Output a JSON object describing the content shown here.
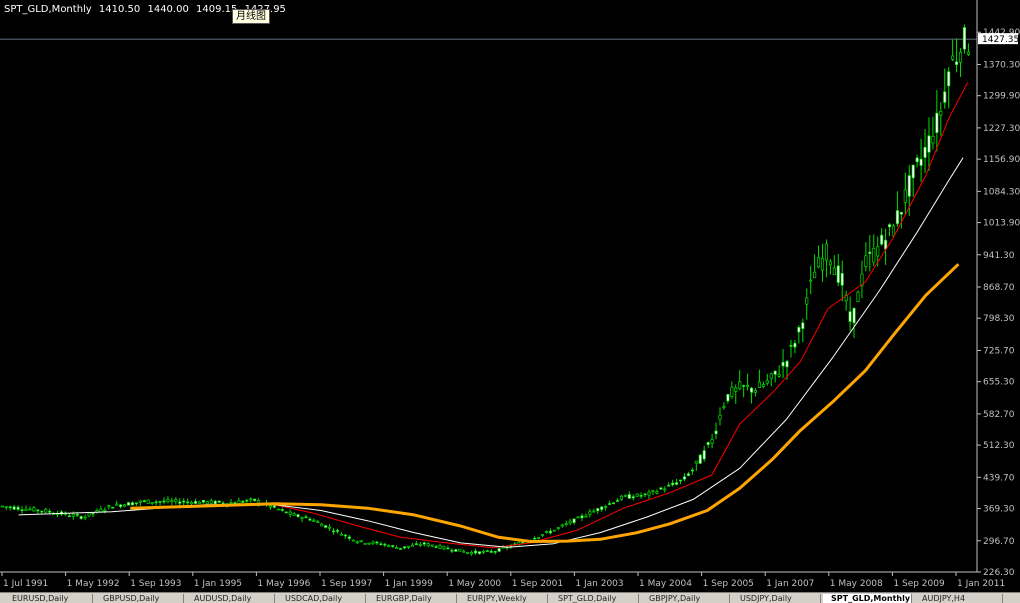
{
  "header": {
    "symbol": "SPT_GLD,Monthly",
    "open": "1410.50",
    "high": "1440.00",
    "low": "1409.15",
    "close": "1427.95"
  },
  "tooltip": "月线图",
  "tabs": [
    {
      "label": "EURUSD,Daily",
      "active": false
    },
    {
      "label": "GBPUSD,Daily",
      "active": false
    },
    {
      "label": "AUDUSD,Daily",
      "active": false
    },
    {
      "label": "USDCAD,Daily",
      "active": false
    },
    {
      "label": "EURGBP,Daily",
      "active": false
    },
    {
      "label": "EURJPY,Weekly",
      "active": false
    },
    {
      "label": "SPT_GLD,Daily",
      "active": false
    },
    {
      "label": "GBPJPY,Daily",
      "active": false
    },
    {
      "label": "USDJPY,Daily",
      "active": false
    },
    {
      "label": "SPT_GLD,Monthly",
      "active": true
    },
    {
      "label": "AUDJPY,H4",
      "active": false
    }
  ],
  "chart_data": {
    "type": "line",
    "subtype": "candlestick-monthly",
    "ylim": [
      226.3,
      1475
    ],
    "y_ticks": [
      "1442.90",
      "1370.30",
      "1299.90",
      "1227.30",
      "1156.90",
      "1084.30",
      "1013.90",
      "941.30",
      "868.70",
      "798.30",
      "725.70",
      "655.30",
      "582.70",
      "512.30",
      "439.70",
      "369.30",
      "296.70",
      "226.30"
    ],
    "current_price": "1427.35",
    "x_ticks": [
      "1 Jul 1991",
      "1 May 1992",
      "1 Sep 1993",
      "1 Jan 1995",
      "1 May 1996",
      "1 Sep 1997",
      "1 Jan 1999",
      "1 May 2000",
      "1 Sep 2001",
      "1 Jan 2003",
      "1 May 2004",
      "1 Sep 2005",
      "1 Jan 2007",
      "1 May 2008",
      "1 Sep 2009",
      "1 Jan 2011"
    ],
    "price_years": [
      1990.6,
      1991.5,
      1992.4,
      1993.0,
      1993.7,
      1994.5,
      1995.5,
      1996.1,
      1996.4,
      1996.9,
      1997.3,
      1997.8,
      1998.3,
      1998.8,
      1999.2,
      1999.7,
      2000.2,
      2000.7,
      2001.2,
      2001.6,
      2002.0,
      2002.5,
      2003.0,
      2003.5,
      2004.0,
      2004.5,
      2005.0,
      2005.3,
      2005.6,
      2005.9,
      2006.2,
      2006.5,
      2006.9,
      2007.2,
      2007.5,
      2007.8,
      2008.1,
      2008.4,
      2008.7,
      2008.9,
      2009.2,
      2009.5,
      2009.8,
      2010.2,
      2010.5,
      2010.8,
      2011.0,
      2011.3
    ],
    "price_values": [
      375,
      365,
      350,
      375,
      385,
      385,
      382,
      388,
      375,
      355,
      345,
      320,
      295,
      290,
      280,
      290,
      280,
      270,
      272,
      285,
      300,
      320,
      345,
      370,
      395,
      400,
      420,
      435,
      470,
      520,
      620,
      640,
      640,
      660,
      700,
      770,
      900,
      950,
      880,
      780,
      920,
      960,
      1000,
      1110,
      1180,
      1250,
      1360,
      1420
    ],
    "series": [
      {
        "color": "#ff0000",
        "years": [
          1996.4,
          1997.3,
          1998.3,
          1999.2,
          2000.2,
          2001.2,
          2002.0,
          2003.0,
          2004.0,
          2005.0,
          2005.9,
          2006.5,
          2007.2,
          2007.8,
          2008.4,
          2009.2,
          2009.8,
          2010.5,
          2011.0,
          2011.4
        ],
        "values": [
          380,
          360,
          330,
          305,
          292,
          281,
          292,
          320,
          370,
          405,
          445,
          560,
          630,
          700,
          820,
          880,
          980,
          1120,
          1250,
          1330
        ]
      },
      {
        "color": "#ffffff",
        "years": [
          1991.0,
          1993.0,
          1995.0,
          1996.5,
          1997.5,
          1998.5,
          1999.5,
          2000.5,
          2001.5,
          2002.5,
          2003.5,
          2004.5,
          2005.5,
          2006.5,
          2007.5,
          2008.5,
          2009.5,
          2010.3,
          2011.0,
          2011.3
        ],
        "values": [
          355,
          362,
          378,
          378,
          365,
          342,
          315,
          292,
          282,
          290,
          315,
          350,
          390,
          460,
          570,
          710,
          860,
          990,
          1110,
          1160
        ]
      },
      {
        "color": "#ffa500",
        "years": [
          1993.4,
          1995.0,
          1996.5,
          1997.5,
          1998.5,
          1999.5,
          2000.5,
          2001.3,
          2002.0,
          2002.8,
          2003.5,
          2004.3,
          2005.0,
          2005.8,
          2006.5,
          2007.2,
          2007.8,
          2008.5,
          2009.2,
          2009.8,
          2010.5,
          2011.2
        ],
        "values": [
          370,
          375,
          380,
          378,
          370,
          355,
          330,
          305,
          295,
          296,
          300,
          315,
          335,
          365,
          415,
          480,
          545,
          610,
          680,
          760,
          850,
          920
        ]
      }
    ]
  }
}
